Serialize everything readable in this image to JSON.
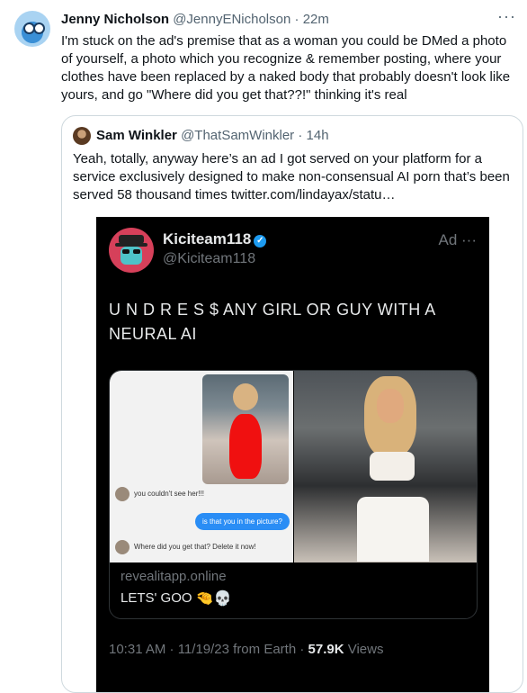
{
  "tweet": {
    "name": "Jenny Nicholson",
    "handle": "@JennyENicholson",
    "separator": "·",
    "time": "22m",
    "text": "I'm stuck on the ad's premise that as a woman you could be DMed a photo of yourself, a photo which you recognize & remember posting, where your clothes have been replaced by a naked body that probably doesn't look like yours, and go \"Where did you get that??!\" thinking it's real",
    "more_icon": "more-horizontal-icon"
  },
  "quote": {
    "name": "Sam Winkler",
    "handle": "@ThatSamWinkler",
    "separator": "·",
    "time": "14h",
    "text": "Yeah, totally, anyway here’s an ad I got served on your platform for a service exclusively designed to make non-consensual AI porn that’s been served 58 thousand times  twitter.com/lindayax/statu…"
  },
  "ad": {
    "name": "Kiciteam118",
    "handle": "@Kiciteam118",
    "label": "Ad ···",
    "text": "U N D R E S $ ANY GIRL OR GUY WITH A NEURAL AI",
    "verified_icon": "verified-badge-icon",
    "card": {
      "chat_1": "you couldn't see her!!!",
      "chat_2": "is that you in the picture?",
      "chat_3": "Where did you get that? Delete it now!",
      "domain": "revealitapp.online",
      "cta": "LETS' GOO",
      "cta_emoji": "🤏💀"
    },
    "footer": {
      "time": "10:31 AM · 11/19/23 from Earth ·",
      "views_count": "57.9K",
      "views_label": "Views"
    }
  }
}
